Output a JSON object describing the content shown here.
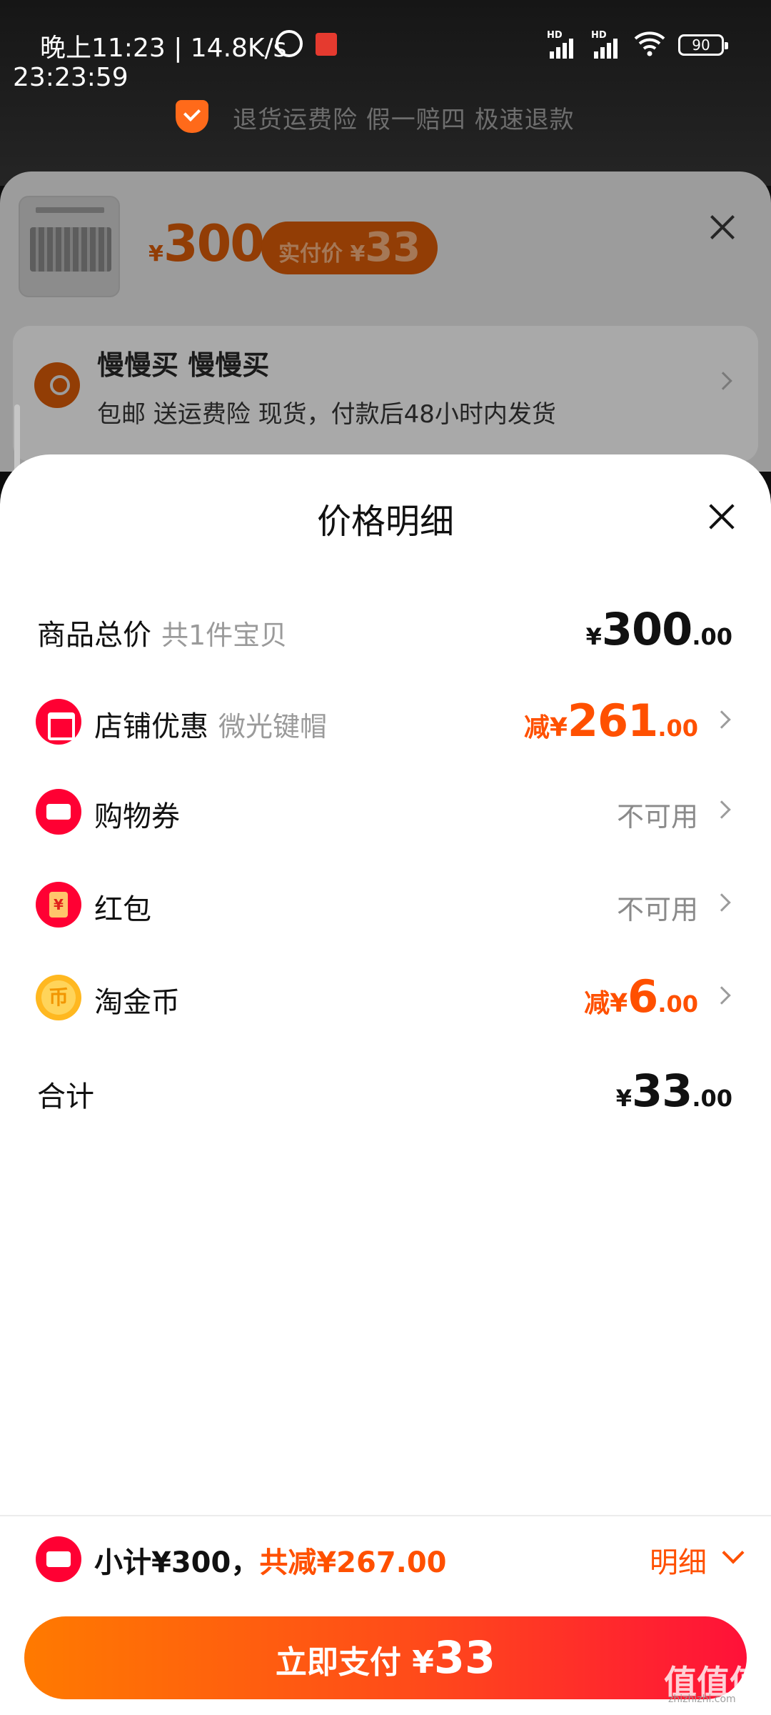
{
  "status_bar": {
    "time_text": "晚上11:23 | 14.8K/s",
    "clock_overlay": "23:23:59",
    "network_label_1": "HD",
    "network_label_2": "HD",
    "battery": "90"
  },
  "promo": {
    "text": "退货运费险 假一赔四 极速退款"
  },
  "product": {
    "currency": "¥",
    "price": "300",
    "actual_label": "实付价",
    "actual_currency": "¥",
    "actual_price": "33"
  },
  "address": {
    "name": "慢慢买 慢慢买",
    "subtitle": "包邮  送运费险  现货，付款后48小时内发货"
  },
  "sheet": {
    "title": "价格明细",
    "rows": [
      {
        "label": "商品总价",
        "sub": "共1件宝贝",
        "currency": "¥",
        "int": "300",
        "dec": ".00"
      },
      {
        "label": "店铺优惠",
        "sub": "微光键帽",
        "prefix": "减¥",
        "int": "261",
        "dec": ".00"
      },
      {
        "label": "购物券",
        "value": "不可用"
      },
      {
        "label": "红包",
        "value": "不可用"
      },
      {
        "label": "淘金币",
        "prefix": "减¥",
        "int": "6",
        "dec": ".00"
      },
      {
        "label": "合计",
        "currency": "¥",
        "int": "33",
        "dec": ".00"
      }
    ]
  },
  "bottom": {
    "subtotal": "小计¥300，",
    "discount": "共减¥267.00",
    "detail_label": "明细",
    "pay_label": "立即支付",
    "pay_currency": "¥",
    "pay_amount": "33"
  },
  "watermark": {
    "main": "值值值",
    "sub": "zhizhizhi.com"
  },
  "colors": {
    "accent": "#ff5000",
    "brand_red": "#ff0033",
    "pay_gradient_start": "#ff7a00",
    "pay_gradient_end": "#ff1139"
  }
}
